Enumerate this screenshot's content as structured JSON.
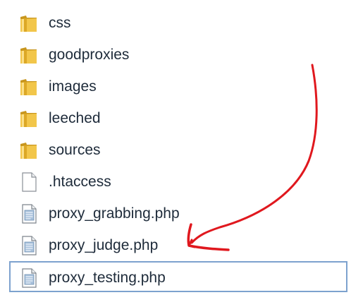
{
  "files": [
    {
      "name": "css",
      "kind": "folder",
      "icon": "folder-icon"
    },
    {
      "name": "goodproxies",
      "kind": "folder",
      "icon": "folder-icon"
    },
    {
      "name": "images",
      "kind": "folder",
      "icon": "folder-icon"
    },
    {
      "name": "leeched",
      "kind": "folder",
      "icon": "folder-icon"
    },
    {
      "name": "sources",
      "kind": "folder",
      "icon": "folder-icon"
    },
    {
      "name": ".htaccess",
      "kind": "file",
      "icon": "blank-file-icon"
    },
    {
      "name": "proxy_grabbing.php",
      "kind": "php",
      "icon": "php-file-icon"
    },
    {
      "name": "proxy_judge.php",
      "kind": "php",
      "icon": "php-file-icon"
    },
    {
      "name": "proxy_testing.php",
      "kind": "php",
      "icon": "php-file-icon",
      "selected": true
    }
  ],
  "colors": {
    "folder": "#e8b830",
    "annotation": "#e0181e",
    "selection_border": "#7da2ce",
    "text": "#1e2b3a"
  },
  "annotation": {
    "icon": "red-arrow-annotation-icon",
    "points_to": "proxy_judge.php"
  }
}
